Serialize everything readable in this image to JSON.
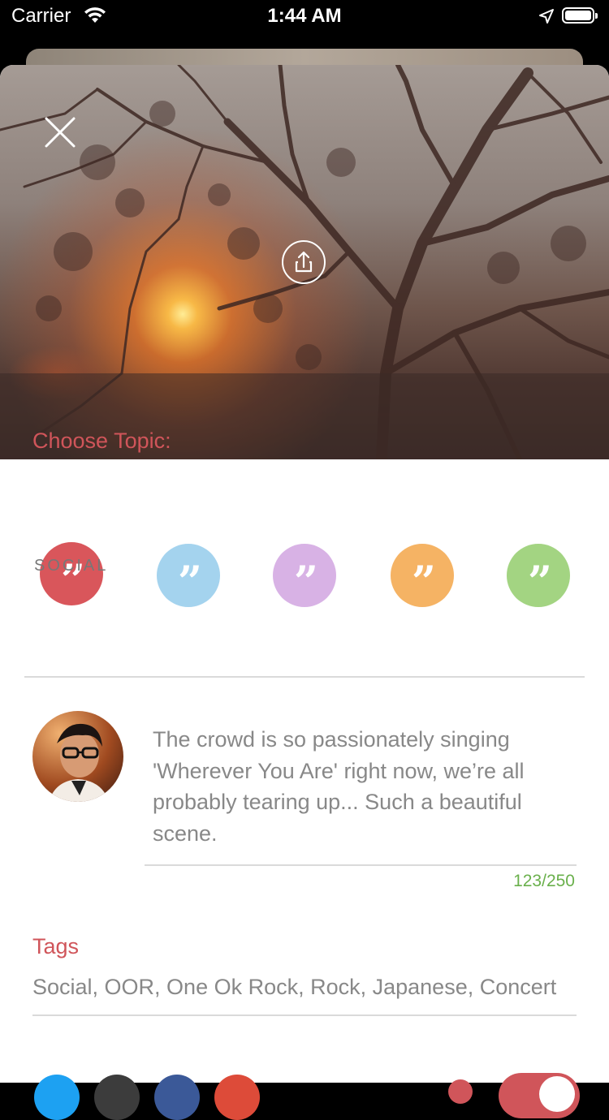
{
  "status_bar": {
    "carrier": "Carrier",
    "time": "1:44 AM"
  },
  "hero": {
    "close_icon": "close-icon",
    "share_icon": "share-icon"
  },
  "topics": {
    "label": "Choose Topic:",
    "items": [
      {
        "color": "#d9565b",
        "label": "SOCIAL",
        "selected": true
      },
      {
        "color": "#a4d3ee",
        "label": "",
        "selected": false
      },
      {
        "color": "#d8b2e5",
        "label": "",
        "selected": false
      },
      {
        "color": "#f5b364",
        "label": "",
        "selected": false
      },
      {
        "color": "#a3d482",
        "label": "",
        "selected": false
      }
    ],
    "quote_glyph": "”"
  },
  "post": {
    "text": "The crowd is so passionately singing 'Wherever You Are' right now, we’re all probably tearing up... Such a beautiful scene.",
    "counter": "123/250"
  },
  "tags": {
    "label": "Tags",
    "value": "Social, OOR, One Ok Rock, Rock, Japanese, Concert"
  },
  "share_targets": [
    {
      "icon": "twitter-icon",
      "color": "#1da1f2"
    },
    {
      "icon": "tumblr-icon",
      "color": "#3c3c3c"
    },
    {
      "icon": "facebook-icon",
      "color": "#3b5998"
    },
    {
      "icon": "google-plus-icon",
      "color": "#dd4b39"
    }
  ],
  "toggle": {
    "on": true,
    "color": "#d0555a"
  }
}
